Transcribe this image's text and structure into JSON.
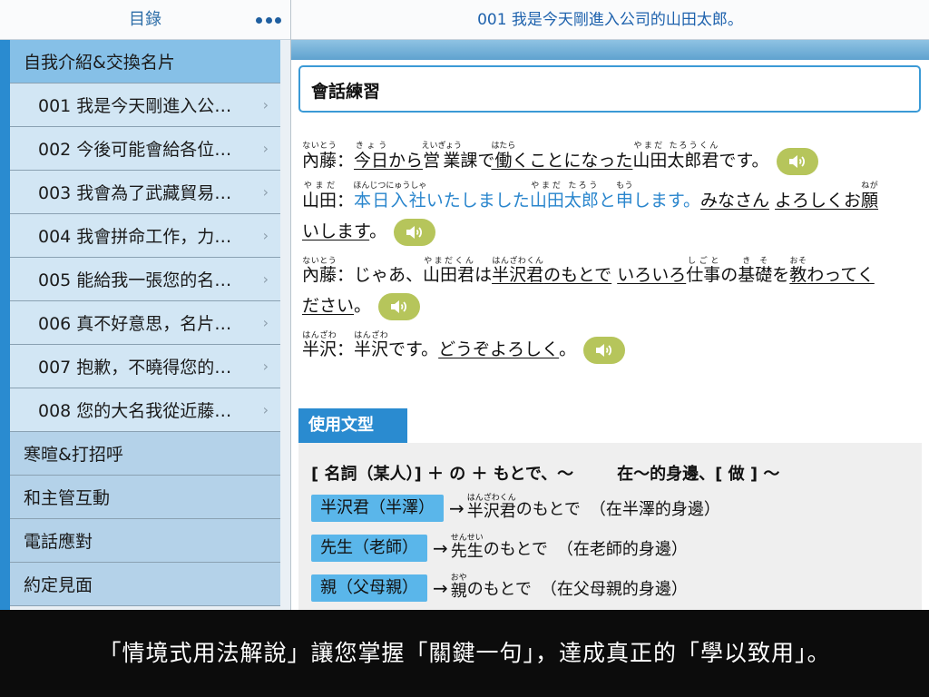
{
  "sidebar": {
    "title": "目錄",
    "more_icon": "ellipsis-icon",
    "items": [
      {
        "label": "自我介紹&交換名片",
        "type": "category",
        "expanded": true
      },
      {
        "label": "001 我是今天剛進入公…",
        "type": "lesson"
      },
      {
        "label": "002 今後可能會給各位…",
        "type": "lesson"
      },
      {
        "label": "003 我會為了武藏貿易…",
        "type": "lesson"
      },
      {
        "label": "004 我會拼命工作，力…",
        "type": "lesson"
      },
      {
        "label": "005 能給我一張您的名…",
        "type": "lesson"
      },
      {
        "label": "006 真不好意思，名片…",
        "type": "lesson"
      },
      {
        "label": "007 抱歉，不曉得您的…",
        "type": "lesson"
      },
      {
        "label": "008 您的大名我從近藤…",
        "type": "lesson"
      },
      {
        "label": "寒暄&打招呼",
        "type": "category"
      },
      {
        "label": "和主管互動",
        "type": "category"
      },
      {
        "label": "電話應對",
        "type": "category"
      },
      {
        "label": "約定見面",
        "type": "category"
      }
    ]
  },
  "main": {
    "title": "001 我是今天剛進入公司的山田太郎。",
    "section_title": "會話練習",
    "dialogue": {
      "l1": {
        "speaker": "內藤：",
        "r1": "今日",
        "r1_rt": "きょう",
        "t1": "から",
        "r2": "営業",
        "r2_rt": "えいぎょう",
        "t2": "課で",
        "r3": "働",
        "r3_rt": "はたら",
        "t3": "くことになった",
        "r4": "山田太郎君",
        "r4_rt": "やまだ たろうくん",
        "t4": "です。"
      },
      "l2": {
        "speaker": "山田：",
        "r1": "本日入社",
        "r1_rt": "ほんじつにゅうしゃ",
        "t1": "いたしました",
        "r2": "山田太郎",
        "r2_rt": "やまだ たろう",
        "t2": "と",
        "r3": "申",
        "r3_rt": "もう",
        "t3": "します。",
        "t4": "みなさん",
        "t5": "よろしくお",
        "r6": "願",
        "r6_rt": "ねが"
      },
      "l2b": {
        "t1": "いします",
        "t2": "。"
      },
      "l3": {
        "speaker": "內藤：",
        "t1": "じゃあ、",
        "r1": "山田君",
        "r1_rt": "やまだくん",
        "t2": "は",
        "r2": "半沢君",
        "r2_rt": "はんざわくん",
        "t3": "のもとで",
        "t4": "いろいろ",
        "r3": "仕事",
        "r3_rt": "しごと",
        "t5": "の",
        "r4": "基礎",
        "r4_rt": "きそ",
        "t6": "を",
        "r5": "教",
        "r5_rt": "おそ",
        "t7": "わってく"
      },
      "l3b": {
        "t1": "ださい",
        "t2": "。"
      },
      "l4": {
        "r1": "半沢",
        "r1_rt": "はんざわ",
        "t1": "：",
        "r2": "半沢",
        "r2_rt": "はんざわ",
        "t2": "です。",
        "t3": "どうぞよろしく",
        "t4": "。"
      },
      "speaker_icon": "speaker-audio-icon"
    },
    "usage": {
      "tab_label": "使用文型",
      "pattern": "[ 名詞（某人）] ＋ の ＋ もとで、～",
      "meaning": "在～的身邊、[ 做 ] ～",
      "examples": [
        {
          "tag": "半沢君（半澤）",
          "ruby": "半沢君",
          "ruby_rt": "はんざわくん",
          "tail": "のもとで",
          "gloss": "（在半澤的身邊）"
        },
        {
          "tag": "先生（老師）",
          "ruby": "先生",
          "ruby_rt": "せんせい",
          "tail": "のもとで",
          "gloss": "（在老師的身邊）"
        },
        {
          "tag": "親（父母親）",
          "ruby": "親",
          "ruby_rt": "おや",
          "tail": "のもとで",
          "gloss": "（在父母親的身邊）"
        }
      ],
      "arrow": "→"
    }
  },
  "caption": "「情境式用法解說」讓您掌握「關鍵一句」，達成真正的「學以致用」。",
  "colors": {
    "accent": "#2a8bd0",
    "speaker_button": "#b6c55b",
    "highlight_text": "#2a86cd",
    "tag_bg": "#5ab6ea"
  }
}
